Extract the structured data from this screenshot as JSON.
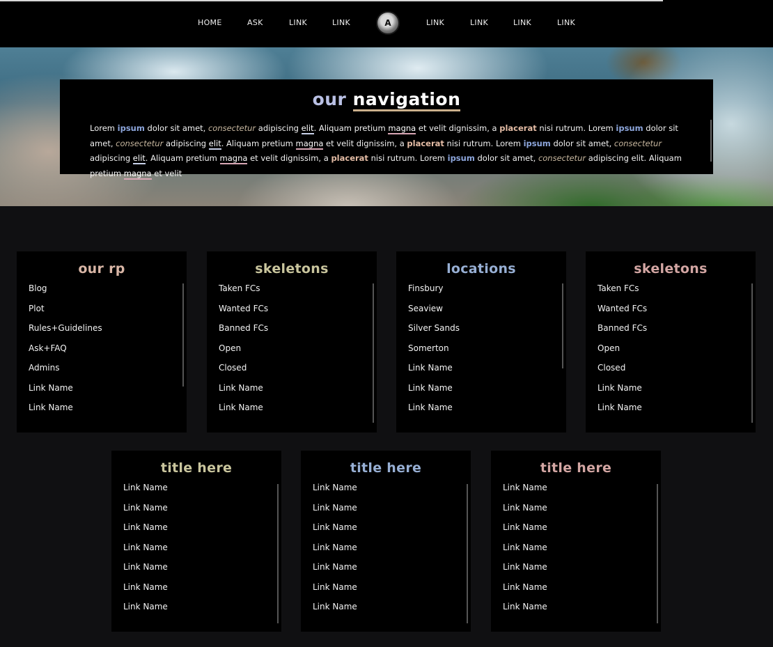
{
  "nav": {
    "left_links": [
      "HOME",
      "ASK",
      "LINK",
      "LINK"
    ],
    "right_links": [
      "LINK",
      "LINK",
      "LINK",
      "LINK"
    ],
    "logo_letter": "A"
  },
  "hero": {
    "title_part1": "our",
    "title_part2": "navigation",
    "paragraph_segments": [
      {
        "t": "Lorem ",
        "s": ""
      },
      {
        "t": "ipsum",
        "s": "ip"
      },
      {
        "t": " dolor sit amet, ",
        "s": ""
      },
      {
        "t": "consectetur",
        "s": "ct"
      },
      {
        "t": " adipiscing ",
        "s": ""
      },
      {
        "t": "elit",
        "s": "el"
      },
      {
        "t": ". Aliquam pretium ",
        "s": ""
      },
      {
        "t": "magna",
        "s": "mg"
      },
      {
        "t": " et velit dignissim, a ",
        "s": ""
      },
      {
        "t": "placerat",
        "s": "pl"
      },
      {
        "t": " nisi rutrum. Lorem ",
        "s": ""
      },
      {
        "t": "ipsum",
        "s": "ip"
      },
      {
        "t": " dolor sit amet, ",
        "s": ""
      },
      {
        "t": "consectetur",
        "s": "ct"
      },
      {
        "t": " adipiscing ",
        "s": ""
      },
      {
        "t": "elit",
        "s": "el"
      },
      {
        "t": ". Aliquam pretium ",
        "s": ""
      },
      {
        "t": "magna",
        "s": "mg"
      },
      {
        "t": " et velit dignissim, a ",
        "s": ""
      },
      {
        "t": "placerat",
        "s": "pl"
      },
      {
        "t": " nisi rutrum. Lorem ",
        "s": ""
      },
      {
        "t": "ipsum",
        "s": "ip"
      },
      {
        "t": " dolor sit amet, ",
        "s": ""
      },
      {
        "t": "consectetur",
        "s": "ct"
      },
      {
        "t": " adipiscing ",
        "s": ""
      },
      {
        "t": "elit",
        "s": "el"
      },
      {
        "t": ". Aliquam pretium ",
        "s": ""
      },
      {
        "t": "magna",
        "s": "mg"
      },
      {
        "t": " et velit dignissim, a ",
        "s": ""
      },
      {
        "t": "placerat",
        "s": "pl"
      },
      {
        "t": " nisi rutrum. Lorem ",
        "s": ""
      },
      {
        "t": "ipsum",
        "s": "ip"
      },
      {
        "t": " dolor sit amet, ",
        "s": ""
      },
      {
        "t": "consectetur",
        "s": "ct"
      },
      {
        "t": " adipiscing elit. Aliquam pretium ",
        "s": ""
      },
      {
        "t": "magna",
        "s": "mg"
      },
      {
        "t": " et velit",
        "s": ""
      }
    ]
  },
  "cards_row1": [
    {
      "title": "our rp",
      "links": [
        "Blog",
        "Plot",
        "Rules+Guidelines",
        "Ask+FAQ",
        "Admins",
        "Link Name",
        "Link Name"
      ]
    },
    {
      "title": "skeletons",
      "links": [
        "Taken FCs",
        "Wanted FCs",
        "Banned FCs",
        "Open",
        "Closed",
        "Link Name",
        "Link Name"
      ]
    },
    {
      "title": "locations",
      "links": [
        "Finsbury",
        "Seaview",
        "Silver Sands",
        "Somerton",
        "Link Name",
        "Link Name",
        "Link Name"
      ]
    },
    {
      "title": "skeletons",
      "links": [
        "Taken FCs",
        "Wanted FCs",
        "Banned FCs",
        "Open",
        "Closed",
        "Link Name",
        "Link Name"
      ]
    }
  ],
  "cards_row2": [
    {
      "title": "title here",
      "links": [
        "Link Name",
        "Link Name",
        "Link Name",
        "Link Name",
        "Link Name",
        "Link Name",
        "Link Name"
      ]
    },
    {
      "title": "title here",
      "links": [
        "Link Name",
        "Link Name",
        "Link Name",
        "Link Name",
        "Link Name",
        "Link Name",
        "Link Name"
      ]
    },
    {
      "title": "title here",
      "links": [
        "Link Name",
        "Link Name",
        "Link Name",
        "Link Name",
        "Link Name",
        "Link Name",
        "Link Name"
      ]
    }
  ],
  "colors": {
    "background": "#101012",
    "panel": "#000000",
    "accent_blue": "#97afd4",
    "accent_khaki": "#c9c59d",
    "accent_rose": "#d3a6a3",
    "accent_peach": "#d9b6a6"
  }
}
